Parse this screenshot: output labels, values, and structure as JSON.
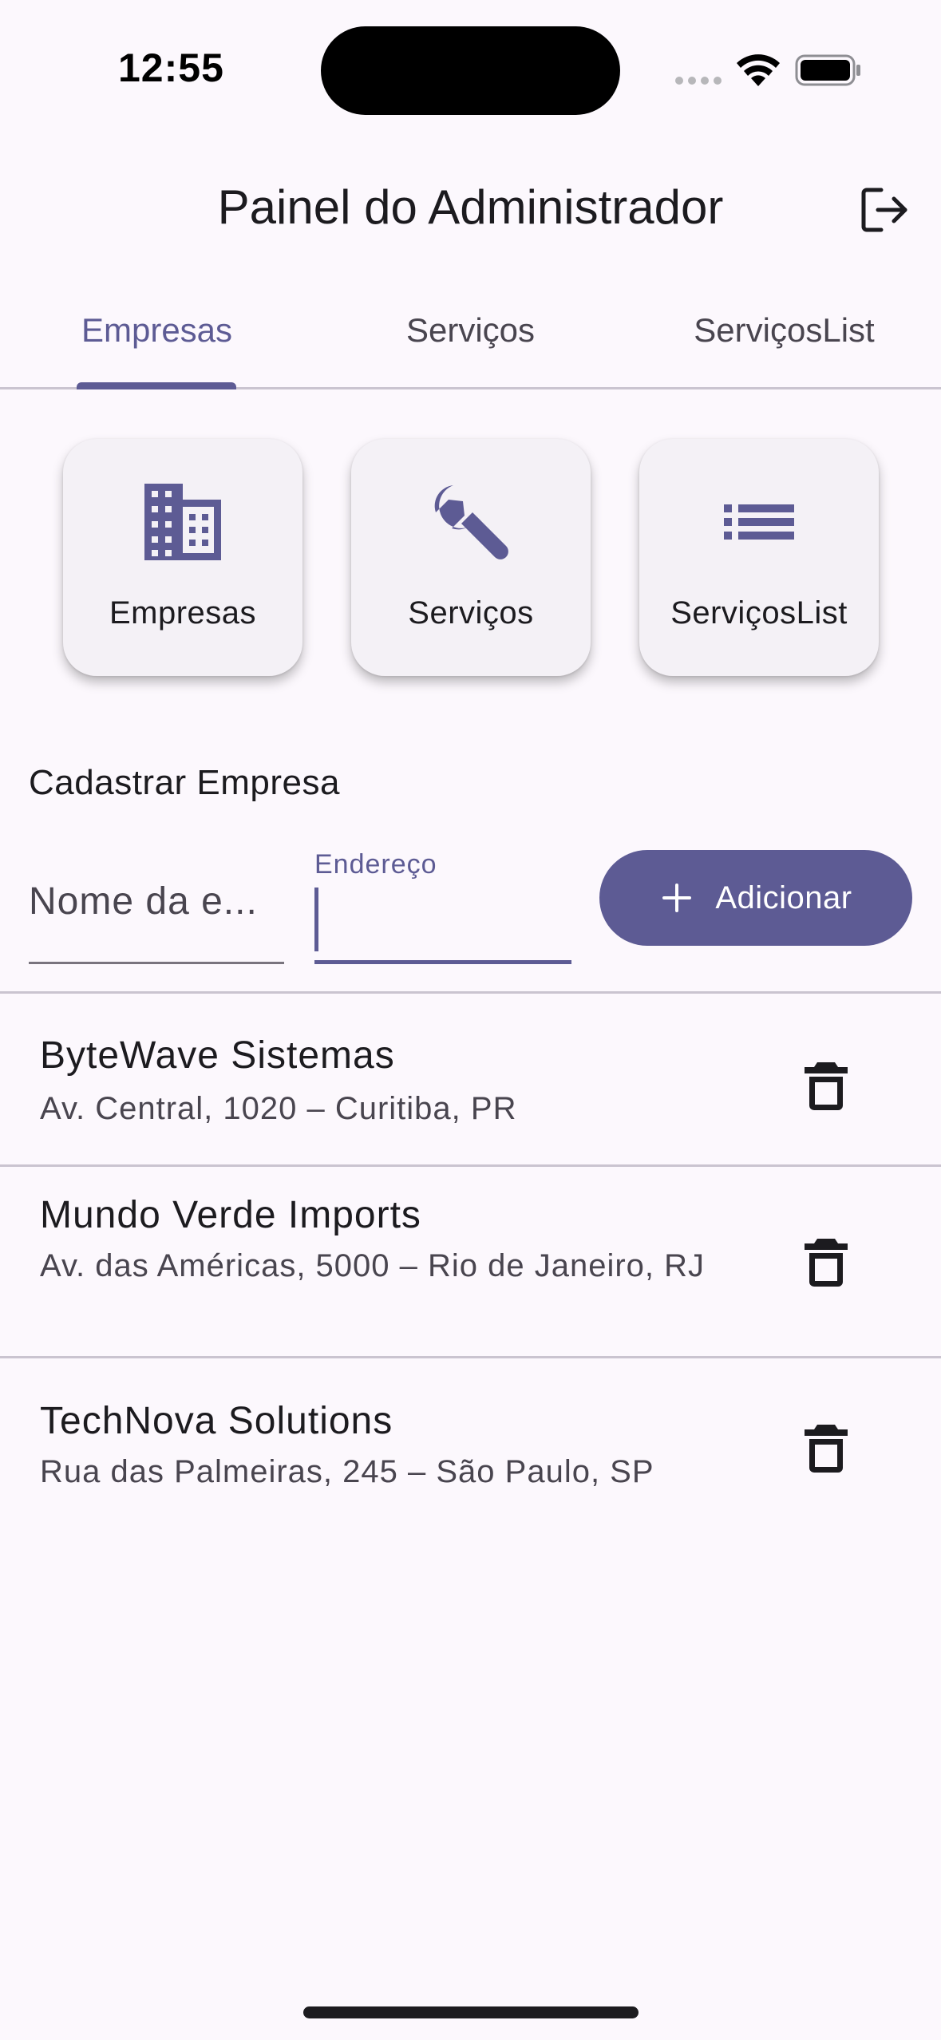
{
  "status_bar": {
    "time": "12:55"
  },
  "app_bar": {
    "title": "Painel do Administrador",
    "logout_icon": "logout-icon"
  },
  "tabs": [
    {
      "label": "Empresas",
      "active": true
    },
    {
      "label": "Serviços",
      "active": false
    },
    {
      "label": "ServiçosList",
      "active": false
    }
  ],
  "shortcuts": [
    {
      "label": "Empresas",
      "icon": "building-icon"
    },
    {
      "label": "Serviços",
      "icon": "wrench-icon"
    },
    {
      "label": "ServiçosList",
      "icon": "list-icon"
    }
  ],
  "form": {
    "section_title": "Cadastrar Empresa",
    "name_placeholder": "Nome da e...",
    "address_label": "Endereço",
    "address_value": "",
    "add_button_label": "Adicionar"
  },
  "companies": [
    {
      "name": "ByteWave Sistemas",
      "address": "Av. Central, 1020 – Curitiba, PR"
    },
    {
      "name": "Mundo Verde Imports",
      "address": "Av. das Américas, 5000 – Rio de Janeiro, RJ"
    },
    {
      "name": "TechNova Solutions",
      "address": "Rua das Palmeiras, 245 – São Paulo, SP"
    }
  ],
  "colors": {
    "accent": "#5d5b94",
    "background": "#fcf8fd",
    "card": "#f4f1f6",
    "divider": "#cac4d0"
  }
}
